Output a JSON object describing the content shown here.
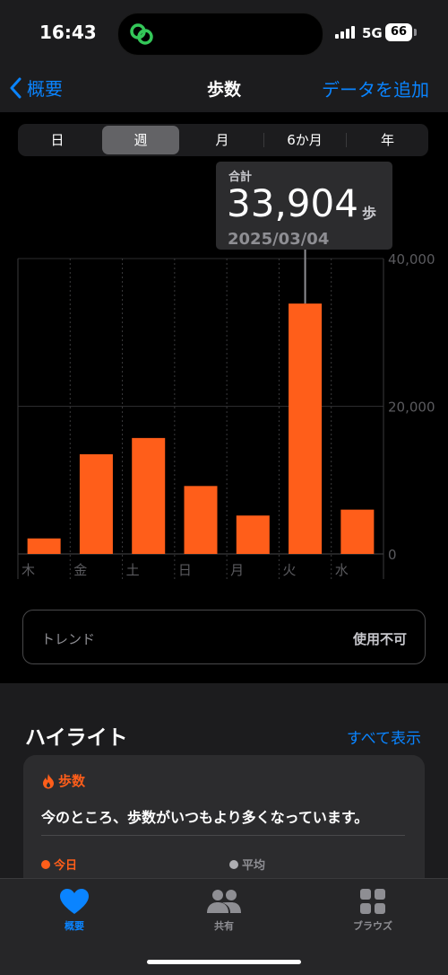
{
  "status": {
    "time": "16:43",
    "network": "5G",
    "battery": "66"
  },
  "nav": {
    "back_label": "概要",
    "title": "歩数",
    "add_label": "データを追加"
  },
  "segments": {
    "items": [
      "日",
      "週",
      "月",
      "6か月",
      "年"
    ],
    "selected": "週"
  },
  "tooltip": {
    "label": "合計",
    "value": "33,904",
    "unit": "歩",
    "date": "2025/03/04"
  },
  "chart_data": {
    "type": "bar",
    "categories": [
      "木",
      "金",
      "土",
      "日",
      "月",
      "火",
      "水"
    ],
    "values": [
      2100,
      13500,
      15700,
      9200,
      5200,
      33904,
      6000
    ],
    "ylim": [
      0,
      40000
    ],
    "y_ticks": [
      0,
      20000,
      40000
    ],
    "y_tick_labels": [
      "0",
      "20,000",
      "40,000"
    ],
    "highlight_index": 5,
    "bar_color": "#ff5e1a",
    "grid": true,
    "y_axis_position": "right"
  },
  "trend": {
    "label": "トレンド",
    "status": "使用不可"
  },
  "highlights": {
    "title": "ハイライト",
    "show_all": "すべて表示",
    "card": {
      "category": "歩数",
      "text": "今のところ、歩数がいつもより多くなっています。",
      "legend_today": "今日",
      "legend_average": "平均"
    }
  },
  "tabs": {
    "summary": "概要",
    "sharing": "共有",
    "browse": "ブラウズ"
  },
  "colors": {
    "accent": "#0a84ff",
    "steps": "#ff5e1a",
    "background": "#000000",
    "card": "#2c2c2e"
  }
}
